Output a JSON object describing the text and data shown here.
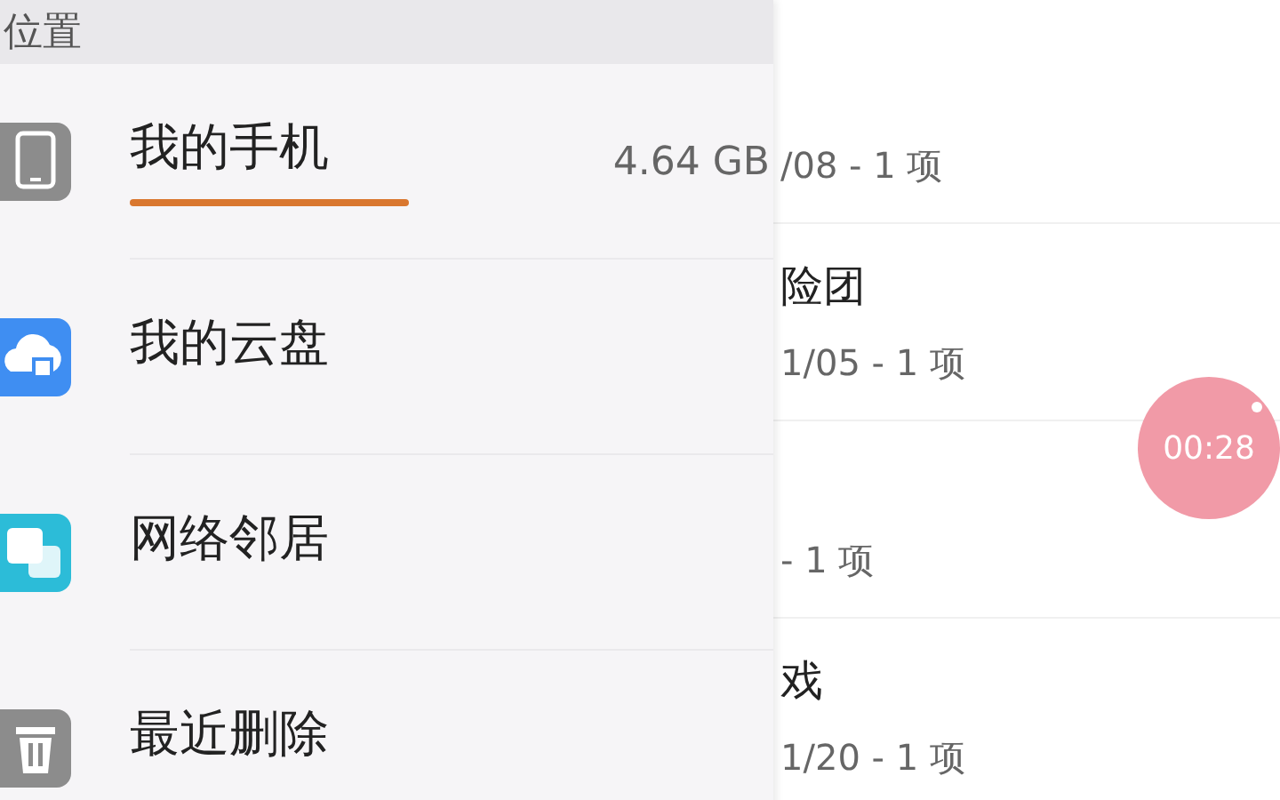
{
  "drawer": {
    "header": "位置",
    "items": [
      {
        "label": "我的手机",
        "kind": "phone",
        "selected": true,
        "detail": "4.64 GB"
      },
      {
        "label": "我的云盘",
        "kind": "cloud",
        "selected": false
      },
      {
        "label": "网络邻居",
        "kind": "network",
        "selected": false
      },
      {
        "label": "最近删除",
        "kind": "trash",
        "selected": false
      }
    ]
  },
  "files": [
    {
      "subtitle": "/08 - 1 项"
    },
    {
      "title": "险团",
      "subtitle": "1/05 - 1 项"
    },
    {
      "subtitle": "- 1 项"
    },
    {
      "title": "戏",
      "subtitle": "1/20 - 1 项"
    }
  ],
  "timer": "00:28"
}
